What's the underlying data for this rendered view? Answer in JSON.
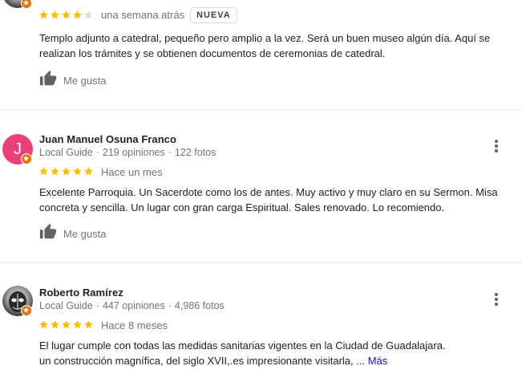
{
  "reviews": [
    {
      "rating": 4,
      "time": "una semana atrás",
      "new_badge": "NUEVA",
      "text": "Templo adjunto a catedral, pequeño pero amplio a la vez. Será un buen museo algún día. Aquí se realizan los trámites y se obtienen documentos de ceremonias de catedral.",
      "like_label": "Me gusta"
    },
    {
      "avatar_letter": "J",
      "name": "Juan Manuel Osuna Franco",
      "guide_label": "Local Guide",
      "reviews_count": "219 opiniones",
      "photos_count": "122 fotos",
      "rating": 5,
      "time": "Hace un mes",
      "text": "Excelente Parroquia. Un Sacerdote como los de antes. Muy activo y muy claro en su Sermon. Misa concreta y sencilla. Un lugar con gran carga Espiritual. Sales renovado. Lo recomiendo.",
      "like_label": "Me gusta"
    },
    {
      "name": "Roberto Ramírez",
      "guide_label": "Local Guide",
      "reviews_count": "447 opiniones",
      "photos_count": "4,986 fotos",
      "rating": 5,
      "time": "Hace 8 meses",
      "text_line1": "El lugar cumple con todas las medidas sanitarias vigentes en la Ciudad de Guadalajara.",
      "text_line2": "un construcción magnífica, del siglo XVII,.es impresionante visitarla, ...",
      "more_label": "Más"
    }
  ],
  "colors": {
    "star_filled": "#fbbc04",
    "star_empty": "#dadce0",
    "avatar_j": "#ec407a",
    "local_guide_badge": "#e8710a",
    "link": "#1a0dab"
  },
  "icons": {
    "like": "thumb-up-icon",
    "menu": "more-vert-icon",
    "guide": "local-guide-badge-icon"
  }
}
